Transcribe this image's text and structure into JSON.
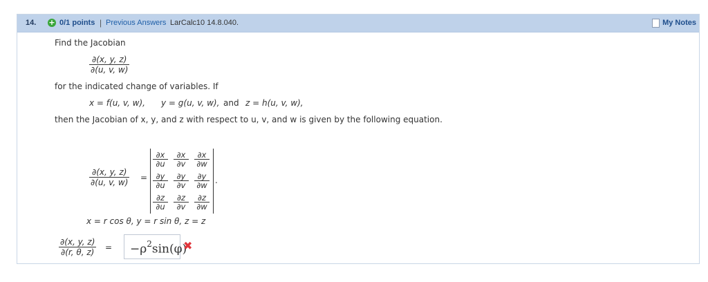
{
  "header": {
    "question_number": "14.",
    "points": "0/1 points",
    "separator": "|",
    "previous_answers": "Previous Answers",
    "reference": "LarCalc10 14.8.040.",
    "notes_label": "My Notes"
  },
  "problem": {
    "intro": "Find the Jacobian",
    "jacobian_num": "∂(x, y, z)",
    "jacobian_den": "∂(u, v, w)",
    "line2": "for the indicated change of variables. If",
    "eq_x": "x = f(u, v, w),",
    "eq_y": "y = g(u, v, w),",
    "eq_and": "and",
    "eq_z": "z = h(u, v, w),",
    "line3": "then the Jacobian of x, y, and z with respect to u, v, and w is given by the following equation.",
    "def_num": "∂(x, y, z)",
    "def_den": "∂(u, v, w)",
    "equals": "=",
    "period": ".",
    "matrix": [
      [
        {
          "n": "∂x",
          "d": "∂u"
        },
        {
          "n": "∂x",
          "d": "∂v"
        },
        {
          "n": "∂x",
          "d": "∂w"
        }
      ],
      [
        {
          "n": "∂y",
          "d": "∂u"
        },
        {
          "n": "∂y",
          "d": "∂v"
        },
        {
          "n": "∂y",
          "d": "∂w"
        }
      ],
      [
        {
          "n": "∂z",
          "d": "∂u"
        },
        {
          "n": "∂z",
          "d": "∂v"
        },
        {
          "n": "∂z",
          "d": "∂w"
        }
      ]
    ],
    "substitution": "x = r cos θ, y = r sin θ, z = z",
    "answer_num": "∂(x, y, z)",
    "answer_den": "∂(r, θ, z)",
    "answer_equals": "=",
    "answer_value": "−ρ",
    "answer_exp": "2",
    "answer_rest": "sin(φ)",
    "status_icon": "x-icon",
    "status_color": "#e0353b"
  }
}
